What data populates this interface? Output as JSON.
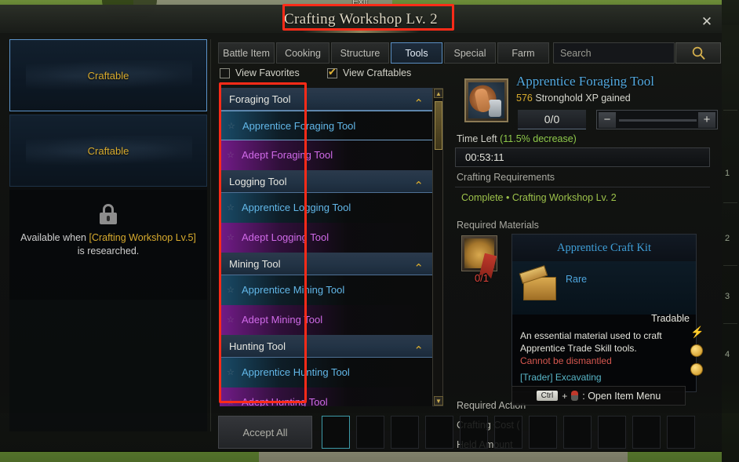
{
  "world": {
    "exit_label": "Exit"
  },
  "window": {
    "title": "Crafting Workshop Lv. 2",
    "close_icon": "close-icon",
    "close_glyph": "✕"
  },
  "left_panel": {
    "slots": [
      {
        "label": "Craftable",
        "selected": true
      },
      {
        "label": "Craftable",
        "selected": false
      }
    ],
    "locked": {
      "lock_icon": "lock-icon",
      "text_before": "Available when ",
      "requirement": "[Crafting Workshop Lv.5]",
      "text_after": " is researched."
    }
  },
  "tabs": [
    {
      "label": "Battle Item",
      "active": false
    },
    {
      "label": "Cooking",
      "active": false
    },
    {
      "label": "Structure",
      "active": false
    },
    {
      "label": "Tools",
      "active": true
    },
    {
      "label": "Special",
      "active": false
    },
    {
      "label": "Farm",
      "active": false
    }
  ],
  "search": {
    "value": "",
    "placeholder": "Search",
    "icon": "search-icon"
  },
  "filters": [
    {
      "label": "View Favorites",
      "checked": false
    },
    {
      "label": "View Craftables",
      "checked": true
    }
  ],
  "recipe_list": [
    {
      "type": "group",
      "label": "Foraging Tool",
      "expanded": true,
      "chevron": "chevron-up-icon"
    },
    {
      "type": "item",
      "label": "Apprentice Foraging Tool",
      "rarity": "blue",
      "selected": true
    },
    {
      "type": "item",
      "label": "Adept Foraging Tool",
      "rarity": "purple",
      "selected": false
    },
    {
      "type": "group",
      "label": "Logging Tool",
      "expanded": true,
      "chevron": "chevron-up-icon"
    },
    {
      "type": "item",
      "label": "Apprentice Logging Tool",
      "rarity": "blue",
      "selected": false
    },
    {
      "type": "item",
      "label": "Adept Logging Tool",
      "rarity": "purple",
      "selected": false
    },
    {
      "type": "group",
      "label": "Mining Tool",
      "expanded": true,
      "chevron": "chevron-up-icon"
    },
    {
      "type": "item",
      "label": "Apprentice Mining Tool",
      "rarity": "blue",
      "selected": false
    },
    {
      "type": "item",
      "label": "Adept Mining Tool",
      "rarity": "purple",
      "selected": false
    },
    {
      "type": "group",
      "label": "Hunting Tool",
      "expanded": true,
      "chevron": "chevron-up-icon"
    },
    {
      "type": "item",
      "label": "Apprentice Hunting Tool",
      "rarity": "blue",
      "selected": false
    },
    {
      "type": "item",
      "label": "Adept Hunting Tool",
      "rarity": "purple",
      "selected": false
    }
  ],
  "scrollbar": {
    "up_icon": "scroll-up-icon",
    "down_icon": "scroll-down-icon",
    "up_glyph": "▲",
    "down_glyph": "▼"
  },
  "detail": {
    "icon": "foraging-tool-icon",
    "title": "Apprentice Foraging Tool",
    "xp_value": "576",
    "xp_text": " Stronghold XP gained",
    "quantity": "0/0",
    "slider": {
      "minus": "−",
      "plus": "+"
    },
    "time_left_label": "Time Left ",
    "time_left_modifier": "(11.5% decrease)",
    "timer": "00:53:11",
    "requirements_label": "Crafting Requirements",
    "requirement_row": "Complete  •  Crafting Workshop Lv. 2",
    "materials_label": "Required Materials",
    "material_count": "0/1",
    "rows": {
      "required_action": "Required Action",
      "crafting_cost": "Crafting Cost (",
      "held_amount": "Held Amount"
    }
  },
  "tooltip": {
    "title": "Apprentice Craft Kit",
    "rarity": "Rare",
    "tradable": "Tradable",
    "description": "An essential material used to craft Apprentice Trade Skill tools.",
    "warning": "Cannot be dismantled",
    "source": "[Trader] Excavating",
    "icon": "craft-kit-icon"
  },
  "side_icons": [
    {
      "name": "lightning-icon",
      "glyph": "⚡"
    },
    {
      "name": "gold-coin-icon"
    },
    {
      "name": "gold-coin-icon"
    }
  ],
  "hotkey_hint": {
    "key": "Ctrl",
    "plus": "+",
    "mouse_icon": "right-mouse-icon",
    "text": ": Open Item Menu"
  },
  "bottom": {
    "accept_all": "Accept All",
    "queue_slots": 12,
    "active_slot_index": 0
  },
  "right_hud": {
    "numbers": [
      "1",
      "2",
      "3",
      "4"
    ]
  },
  "colors": {
    "accent_blue": "#52a9e0",
    "accent_purple": "#d06ae8",
    "gold": "#d8ab2e",
    "green": "#9dc24a",
    "red_warn": "#d6574f",
    "cyan": "#59b7c9",
    "annotation_red": "#fe2b18"
  }
}
